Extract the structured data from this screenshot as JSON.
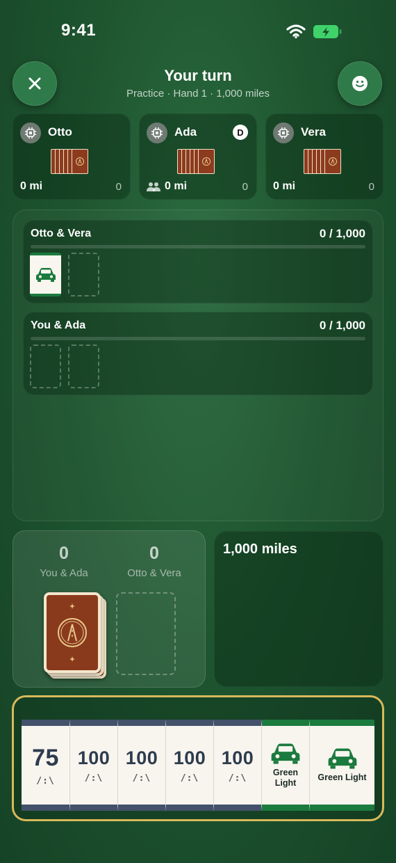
{
  "status_bar": {
    "time": "9:41"
  },
  "header": {
    "title": "Your turn",
    "subtitle": "Practice · Hand 1 · 1,000 miles",
    "close_icon": "close-icon",
    "emoji_icon": "smiley-icon"
  },
  "players": [
    {
      "name": "Otto",
      "miles": "0 mi",
      "count": "0",
      "dealer": false,
      "partner": false
    },
    {
      "name": "Ada",
      "miles": "0 mi",
      "count": "0",
      "dealer": true,
      "dealer_label": "D",
      "partner": true
    },
    {
      "name": "Vera",
      "miles": "0 mi",
      "count": "0",
      "dealer": false,
      "partner": false
    }
  ],
  "teams": [
    {
      "name": "Otto & Vera",
      "score": "0 / 1,000",
      "progress": 0
    },
    {
      "name": "You & Ada",
      "score": "0 / 1,000",
      "progress": 0
    }
  ],
  "scoreboard": {
    "left": {
      "value": "0",
      "label": "You & Ada"
    },
    "right": {
      "value": "0",
      "label": "Otto & Vera"
    }
  },
  "goal": {
    "label": "1,000 miles"
  },
  "hand": [
    {
      "type": "miles",
      "value": "75",
      "symbol": "/:\\"
    },
    {
      "type": "miles",
      "value": "100",
      "symbol": "/:\\"
    },
    {
      "type": "miles",
      "value": "100",
      "symbol": "/:\\"
    },
    {
      "type": "miles",
      "value": "100",
      "symbol": "/:\\"
    },
    {
      "type": "miles",
      "value": "100",
      "symbol": "/:\\"
    },
    {
      "type": "remedy",
      "label": "Green Light"
    },
    {
      "type": "remedy",
      "label": "Green Light"
    }
  ],
  "colors": {
    "accent_green": "#1b7a3e",
    "hand_border": "#d8b95a",
    "miles_band": "#43516a"
  }
}
